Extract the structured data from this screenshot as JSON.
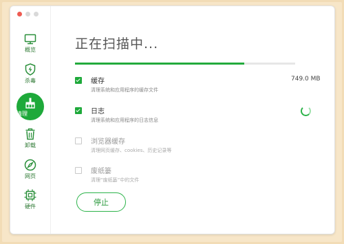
{
  "window": {
    "traffic_lights": [
      "close",
      "minimize",
      "zoom"
    ],
    "colors": {
      "accent": "#1ea93a",
      "close": "#ee5b52",
      "inactive": "#d9d9d9"
    }
  },
  "sidebar": {
    "items": [
      {
        "label": "概览",
        "icon": "monitor-icon",
        "active": false
      },
      {
        "label": "杀毒",
        "icon": "shield-bolt-icon",
        "active": false
      },
      {
        "label": "清理",
        "icon": "broom-icon",
        "active": true
      },
      {
        "label": "卸载",
        "icon": "trash-icon",
        "active": false
      },
      {
        "label": "网页",
        "icon": "compass-icon",
        "active": false
      },
      {
        "label": "硬件",
        "icon": "chip-icon",
        "active": false
      }
    ]
  },
  "main": {
    "title": "正在扫描中...",
    "progress_fraction": 0.77,
    "items": [
      {
        "title": "缓存",
        "desc": "清理系统和应用程序的缓存文件",
        "checked": true,
        "size": "749.0 MB",
        "status": "done"
      },
      {
        "title": "日志",
        "desc": "清理系统和应用程序的日志信息",
        "checked": true,
        "size": "",
        "status": "scanning"
      },
      {
        "title": "浏览器缓存",
        "desc": "清理网页缓存、cookies、历史记录等",
        "checked": false,
        "size": "",
        "status": "pending"
      },
      {
        "title": "废纸篓",
        "desc": "清理“废纸篓”中的文件",
        "checked": false,
        "size": "",
        "status": "pending"
      }
    ],
    "stop_label": "停止"
  }
}
